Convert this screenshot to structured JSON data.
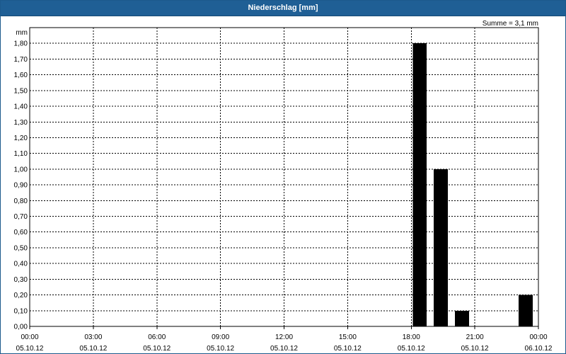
{
  "window": {
    "title": "Niederschlag [mm]"
  },
  "summary": {
    "text": "Summe = 3,1 mm"
  },
  "chart_data": {
    "type": "bar",
    "title": "Niederschlag [mm]",
    "ylabel": "mm",
    "xlabel": "",
    "ylim": [
      0,
      1.9
    ],
    "xlim_hours": [
      0,
      24
    ],
    "yticks": [
      {
        "value": 0.0,
        "label": "0,00"
      },
      {
        "value": 0.1,
        "label": "0,10"
      },
      {
        "value": 0.2,
        "label": "0,20"
      },
      {
        "value": 0.3,
        "label": "0,30"
      },
      {
        "value": 0.4,
        "label": "0,40"
      },
      {
        "value": 0.5,
        "label": "0,50"
      },
      {
        "value": 0.6,
        "label": "0,60"
      },
      {
        "value": 0.7,
        "label": "0,70"
      },
      {
        "value": 0.8,
        "label": "0,80"
      },
      {
        "value": 0.9,
        "label": "0,90"
      },
      {
        "value": 1.0,
        "label": "1,00"
      },
      {
        "value": 1.1,
        "label": "1,10"
      },
      {
        "value": 1.2,
        "label": "1,20"
      },
      {
        "value": 1.3,
        "label": "1,30"
      },
      {
        "value": 1.4,
        "label": "1,40"
      },
      {
        "value": 1.5,
        "label": "1,50"
      },
      {
        "value": 1.6,
        "label": "1,60"
      },
      {
        "value": 1.7,
        "label": "1,70"
      },
      {
        "value": 1.8,
        "label": "1,80"
      }
    ],
    "xticks": [
      {
        "hour": 0,
        "time": "00:00",
        "date": "05.10.12"
      },
      {
        "hour": 3,
        "time": "03:00",
        "date": "05.10.12"
      },
      {
        "hour": 6,
        "time": "06:00",
        "date": "05.10.12"
      },
      {
        "hour": 9,
        "time": "09:00",
        "date": "05.10.12"
      },
      {
        "hour": 12,
        "time": "12:00",
        "date": "05.10.12"
      },
      {
        "hour": 15,
        "time": "15:00",
        "date": "05.10.12"
      },
      {
        "hour": 18,
        "time": "18:00",
        "date": "05.10.12"
      },
      {
        "hour": 21,
        "time": "21:00",
        "date": "05.10.12"
      },
      {
        "hour": 24,
        "time": "00:00",
        "date": "06.10.12"
      }
    ],
    "bars": [
      {
        "start_hour": 18,
        "end_hour": 19,
        "value": 1.8
      },
      {
        "start_hour": 19,
        "end_hour": 20,
        "value": 1.0
      },
      {
        "start_hour": 20,
        "end_hour": 21,
        "value": 0.1
      },
      {
        "start_hour": 23,
        "end_hour": 24,
        "value": 0.2
      }
    ],
    "grid": true,
    "bar_color": "#000000"
  }
}
